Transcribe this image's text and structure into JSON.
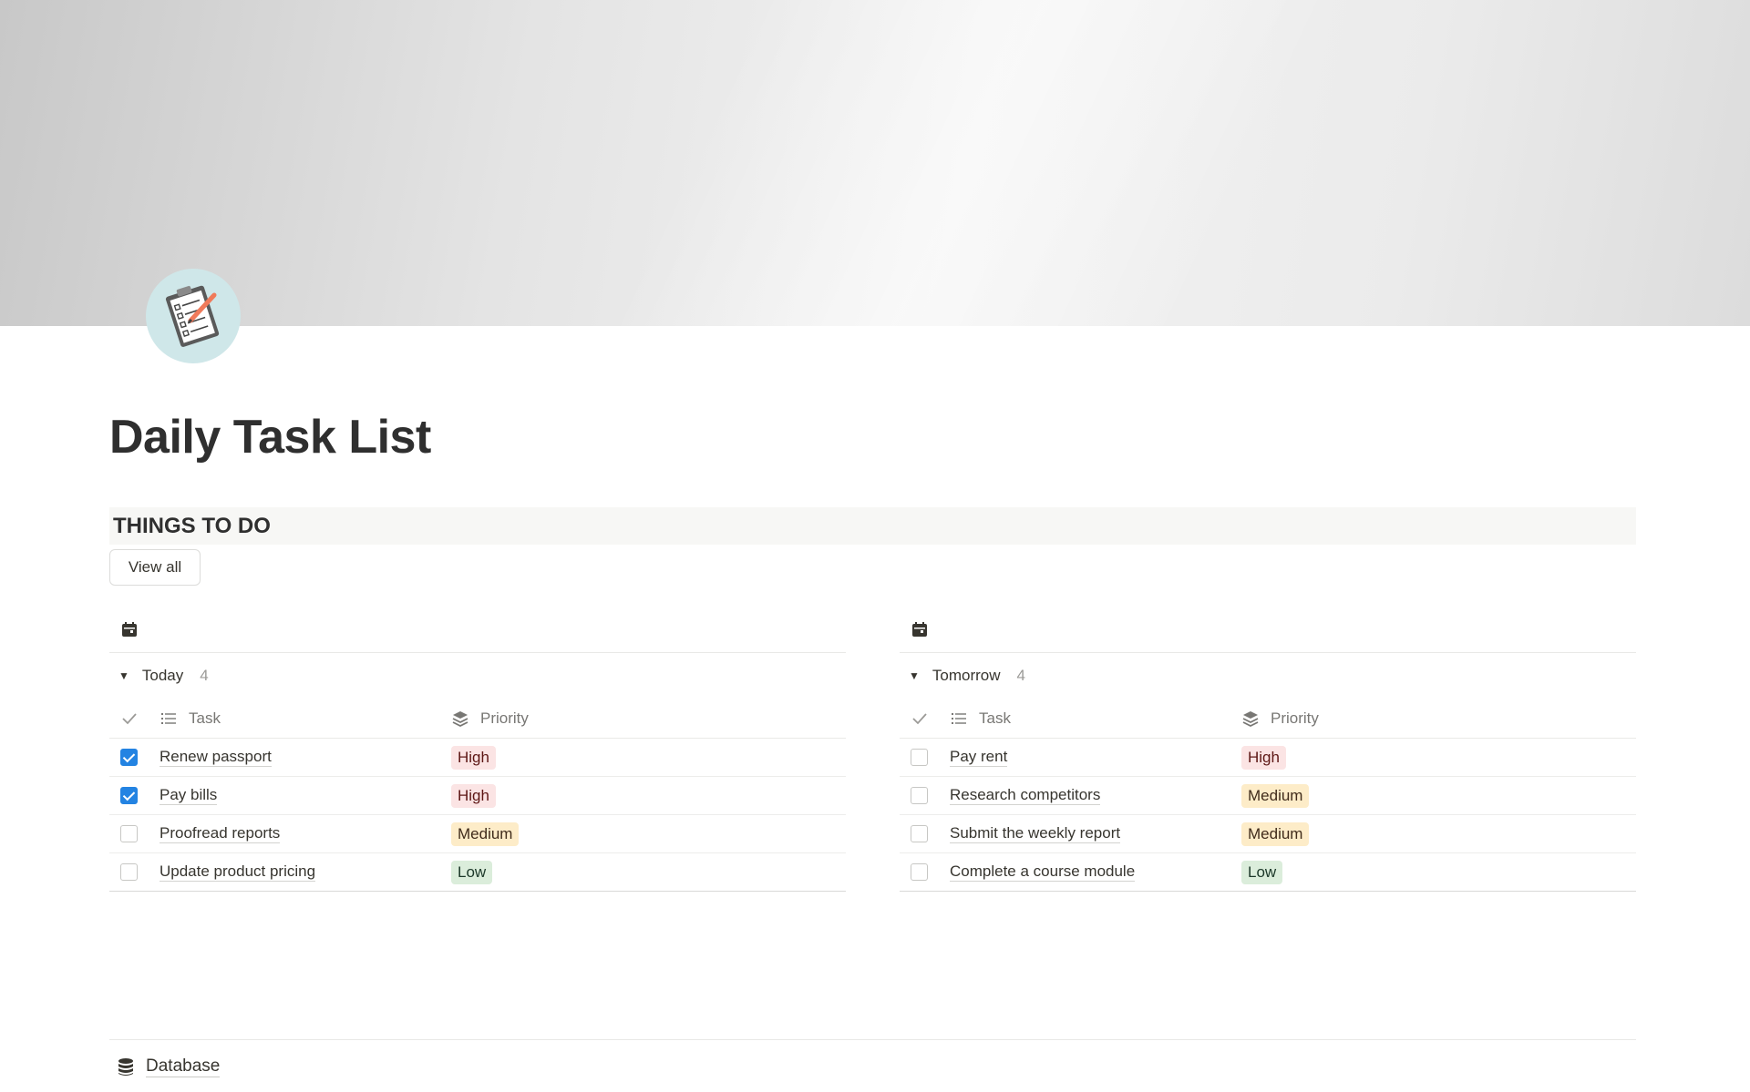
{
  "page": {
    "title": "Daily Task List",
    "icon": "clipboard-checklist-icon"
  },
  "section": {
    "heading": "THINGS TO DO",
    "view_all_label": "View all"
  },
  "columns": {
    "task": "Task",
    "priority": "Priority"
  },
  "boards": [
    {
      "group": "Today",
      "count": "4",
      "rows": [
        {
          "task": "Renew passport",
          "priority": "High",
          "done": true
        },
        {
          "task": "Pay bills",
          "priority": "High",
          "done": true
        },
        {
          "task": "Proofread reports",
          "priority": "Medium",
          "done": false
        },
        {
          "task": "Update product pricing",
          "priority": "Low",
          "done": false
        }
      ]
    },
    {
      "group": "Tomorrow",
      "count": "4",
      "rows": [
        {
          "task": "Pay rent",
          "priority": "High",
          "done": false
        },
        {
          "task": "Research competitors",
          "priority": "Medium",
          "done": false
        },
        {
          "task": "Submit the weekly report",
          "priority": "Medium",
          "done": false
        },
        {
          "task": "Complete a course module",
          "priority": "Low",
          "done": false
        }
      ]
    }
  ],
  "footer": {
    "database_label": "Database"
  },
  "colors": {
    "high_bg": "#fbe4e4",
    "medium_bg": "#fdecc8",
    "low_bg": "#dbeddb",
    "checkbox_checked": "#2383e2"
  }
}
